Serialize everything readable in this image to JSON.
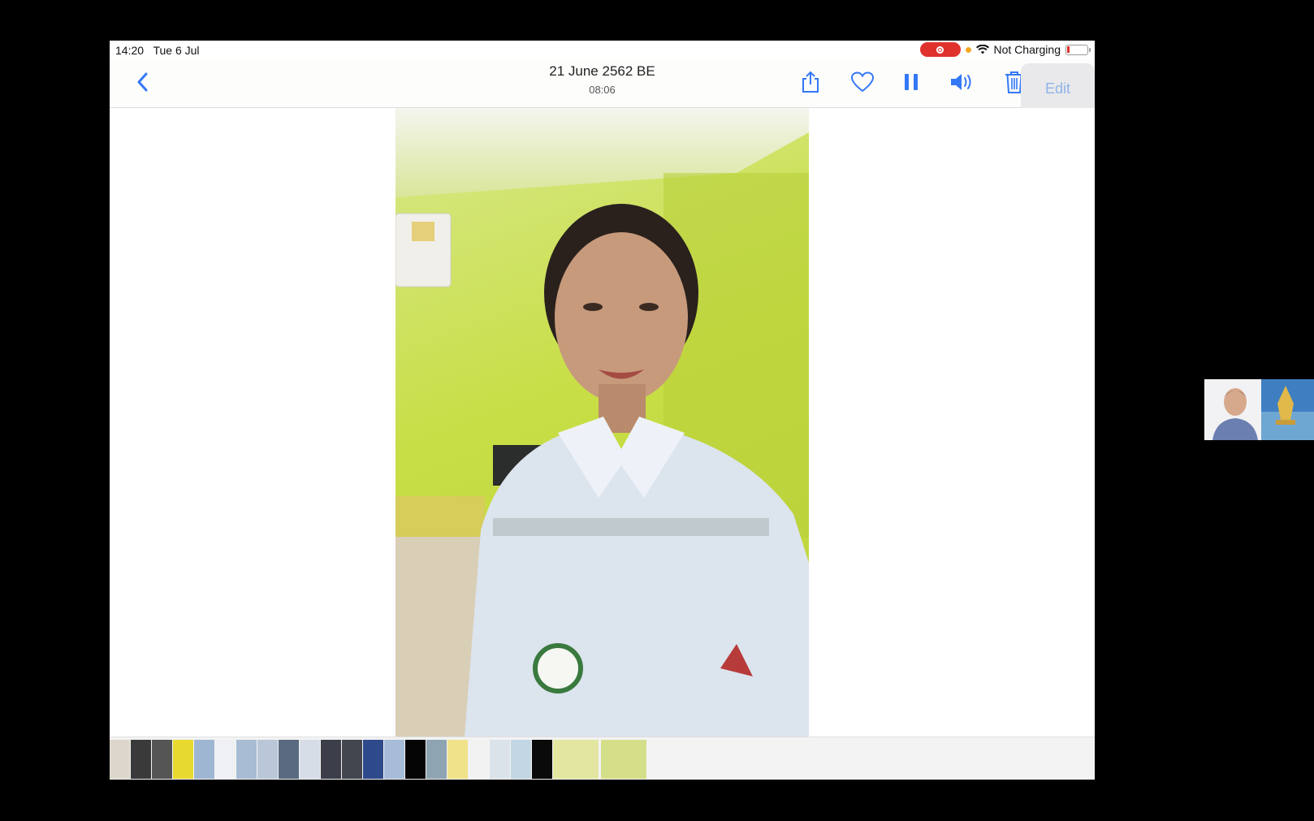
{
  "status_bar": {
    "time": "14:20",
    "date": "Tue 6 Jul",
    "charging": "Not Charging"
  },
  "nav": {
    "date": "21 June 2562 BE",
    "time": "08:06",
    "edit_label": "Edit"
  },
  "icons": {
    "back": "chevron-left-icon",
    "share": "share-icon",
    "favorite": "heart-icon",
    "pause": "pause-icon",
    "volume": "speaker-icon",
    "trash": "trash-icon"
  },
  "colors": {
    "accent": "#3478f6",
    "record": "#e0322d",
    "video_wall": "#c8de45",
    "uniform": "#dce4ee"
  },
  "thumbnail_colors": [
    "#ddd6cc",
    "#3a3a3a",
    "#555555",
    "#e8d92f",
    "#9fb6d2",
    "#eef0f3",
    "#a8bcd4",
    "#b9c7d8",
    "#5a6a80",
    "#d6dde7",
    "#3c3e4a",
    "#44464f",
    "#2e4a8a",
    "#a6bcd8",
    "#050505",
    "#8fa4b2",
    "#f0e28a",
    "#f2f2f2",
    "#dbe3ea",
    "#c2d6e3",
    "#0a0a0a",
    "#e3e6a0",
    "#d5df8a"
  ]
}
